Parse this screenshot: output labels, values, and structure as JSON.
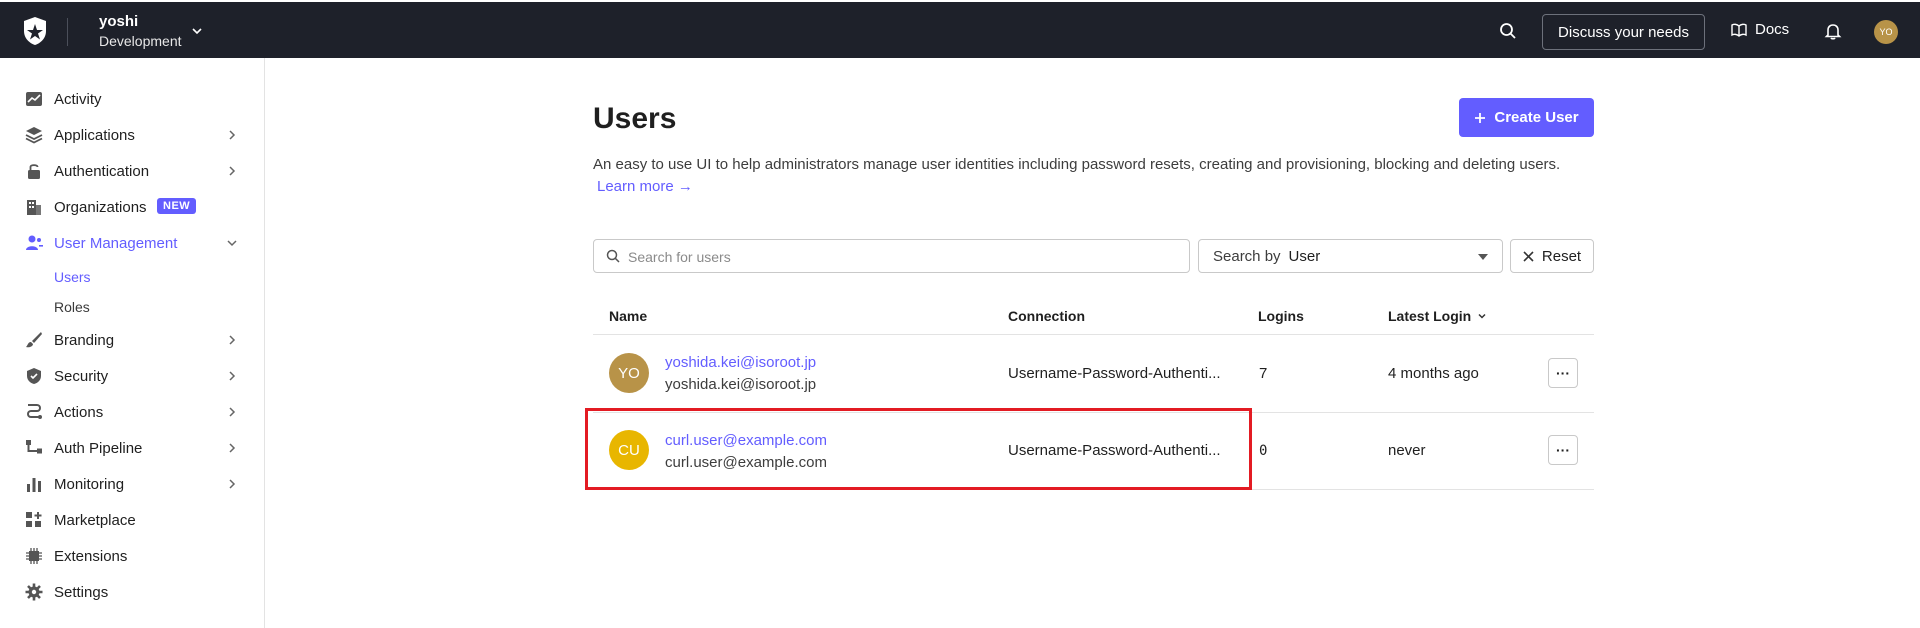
{
  "topbar": {
    "tenant_name": "yoshi",
    "tenant_env": "Development",
    "discuss_label": "Discuss your needs",
    "docs_label": "Docs",
    "avatar_initials": "YO"
  },
  "sidebar": {
    "items": [
      {
        "label": "Activity"
      },
      {
        "label": "Applications"
      },
      {
        "label": "Authentication"
      },
      {
        "label": "Organizations",
        "badge": "NEW"
      },
      {
        "label": "User Management"
      },
      {
        "label": "Branding"
      },
      {
        "label": "Security"
      },
      {
        "label": "Actions"
      },
      {
        "label": "Auth Pipeline"
      },
      {
        "label": "Monitoring"
      },
      {
        "label": "Marketplace"
      },
      {
        "label": "Extensions"
      },
      {
        "label": "Settings"
      }
    ],
    "sub_items": [
      {
        "label": "Users"
      },
      {
        "label": "Roles"
      }
    ]
  },
  "main": {
    "title": "Users",
    "create_label": "Create User",
    "description": "An easy to use UI to help administrators manage user identities including password resets, creating and provisioning, blocking and deleting users.",
    "learn_more": "Learn more →",
    "search_placeholder": "Search for users",
    "search_by_prefix": "Search by",
    "search_by_value": "User",
    "reset_label": "Reset",
    "columns": {
      "name": "Name",
      "connection": "Connection",
      "logins": "Logins",
      "latest_login": "Latest Login"
    },
    "rows": [
      {
        "initials": "YO",
        "email": "yoshida.kei@isoroot.jp",
        "sub": "yoshida.kei@isoroot.jp",
        "connection": "Username-Password-Authenti...",
        "logins": "7",
        "latest": "4 months ago",
        "avatar_color": "#b89348"
      },
      {
        "initials": "CU",
        "email": "curl.user@example.com",
        "sub": "curl.user@example.com",
        "connection": "Username-Password-Authenti...",
        "logins": "0",
        "latest": "never",
        "avatar_color": "#e8b600"
      }
    ],
    "more_label": "···"
  },
  "colors": {
    "accent": "#635dff",
    "topbar_bg": "#1e212a",
    "highlight": "#e31b23"
  }
}
